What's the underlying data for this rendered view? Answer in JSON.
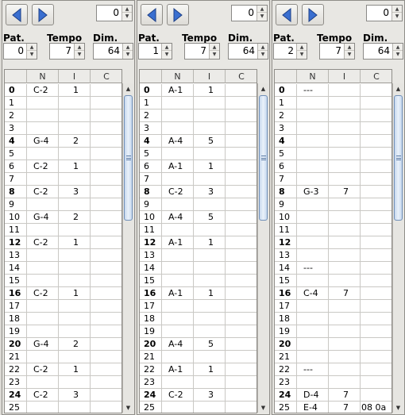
{
  "labels": {
    "pattern": "Pat.",
    "tempo": "Tempo",
    "dim": "Dim."
  },
  "columns": [
    "N",
    "I",
    "C"
  ],
  "panels": [
    {
      "top_value": "0",
      "pattern": "0",
      "tempo": "7",
      "dim": "64",
      "rows": [
        {
          "n": "0",
          "note": "C-2",
          "inst": "1",
          "cmd": ""
        },
        {
          "n": "1",
          "note": "",
          "inst": "",
          "cmd": ""
        },
        {
          "n": "2",
          "note": "",
          "inst": "",
          "cmd": ""
        },
        {
          "n": "3",
          "note": "",
          "inst": "",
          "cmd": ""
        },
        {
          "n": "4",
          "note": "G-4",
          "inst": "2",
          "cmd": ""
        },
        {
          "n": "5",
          "note": "",
          "inst": "",
          "cmd": ""
        },
        {
          "n": "6",
          "note": "C-2",
          "inst": "1",
          "cmd": ""
        },
        {
          "n": "7",
          "note": "",
          "inst": "",
          "cmd": ""
        },
        {
          "n": "8",
          "note": "C-2",
          "inst": "3",
          "cmd": ""
        },
        {
          "n": "9",
          "note": "",
          "inst": "",
          "cmd": ""
        },
        {
          "n": "10",
          "note": "G-4",
          "inst": "2",
          "cmd": ""
        },
        {
          "n": "11",
          "note": "",
          "inst": "",
          "cmd": ""
        },
        {
          "n": "12",
          "note": "C-2",
          "inst": "1",
          "cmd": ""
        },
        {
          "n": "13",
          "note": "",
          "inst": "",
          "cmd": ""
        },
        {
          "n": "14",
          "note": "",
          "inst": "",
          "cmd": ""
        },
        {
          "n": "15",
          "note": "",
          "inst": "",
          "cmd": ""
        },
        {
          "n": "16",
          "note": "C-2",
          "inst": "1",
          "cmd": ""
        },
        {
          "n": "17",
          "note": "",
          "inst": "",
          "cmd": ""
        },
        {
          "n": "18",
          "note": "",
          "inst": "",
          "cmd": ""
        },
        {
          "n": "19",
          "note": "",
          "inst": "",
          "cmd": ""
        },
        {
          "n": "20",
          "note": "G-4",
          "inst": "2",
          "cmd": ""
        },
        {
          "n": "21",
          "note": "",
          "inst": "",
          "cmd": ""
        },
        {
          "n": "22",
          "note": "C-2",
          "inst": "1",
          "cmd": ""
        },
        {
          "n": "23",
          "note": "",
          "inst": "",
          "cmd": ""
        },
        {
          "n": "24",
          "note": "C-2",
          "inst": "3",
          "cmd": ""
        },
        {
          "n": "25",
          "note": "",
          "inst": "",
          "cmd": ""
        }
      ]
    },
    {
      "top_value": "0",
      "pattern": "1",
      "tempo": "7",
      "dim": "64",
      "rows": [
        {
          "n": "0",
          "note": "A-1",
          "inst": "1",
          "cmd": ""
        },
        {
          "n": "1",
          "note": "",
          "inst": "",
          "cmd": ""
        },
        {
          "n": "2",
          "note": "",
          "inst": "",
          "cmd": ""
        },
        {
          "n": "3",
          "note": "",
          "inst": "",
          "cmd": ""
        },
        {
          "n": "4",
          "note": "A-4",
          "inst": "5",
          "cmd": ""
        },
        {
          "n": "5",
          "note": "",
          "inst": "",
          "cmd": ""
        },
        {
          "n": "6",
          "note": "A-1",
          "inst": "1",
          "cmd": ""
        },
        {
          "n": "7",
          "note": "",
          "inst": "",
          "cmd": ""
        },
        {
          "n": "8",
          "note": "C-2",
          "inst": "3",
          "cmd": ""
        },
        {
          "n": "9",
          "note": "",
          "inst": "",
          "cmd": ""
        },
        {
          "n": "10",
          "note": "A-4",
          "inst": "5",
          "cmd": ""
        },
        {
          "n": "11",
          "note": "",
          "inst": "",
          "cmd": ""
        },
        {
          "n": "12",
          "note": "A-1",
          "inst": "1",
          "cmd": ""
        },
        {
          "n": "13",
          "note": "",
          "inst": "",
          "cmd": ""
        },
        {
          "n": "14",
          "note": "",
          "inst": "",
          "cmd": ""
        },
        {
          "n": "15",
          "note": "",
          "inst": "",
          "cmd": ""
        },
        {
          "n": "16",
          "note": "A-1",
          "inst": "1",
          "cmd": ""
        },
        {
          "n": "17",
          "note": "",
          "inst": "",
          "cmd": ""
        },
        {
          "n": "18",
          "note": "",
          "inst": "",
          "cmd": ""
        },
        {
          "n": "19",
          "note": "",
          "inst": "",
          "cmd": ""
        },
        {
          "n": "20",
          "note": "A-4",
          "inst": "5",
          "cmd": ""
        },
        {
          "n": "21",
          "note": "",
          "inst": "",
          "cmd": ""
        },
        {
          "n": "22",
          "note": "A-1",
          "inst": "1",
          "cmd": ""
        },
        {
          "n": "23",
          "note": "",
          "inst": "",
          "cmd": ""
        },
        {
          "n": "24",
          "note": "C-2",
          "inst": "3",
          "cmd": ""
        },
        {
          "n": "25",
          "note": "",
          "inst": "",
          "cmd": ""
        }
      ]
    },
    {
      "top_value": "0",
      "pattern": "2",
      "tempo": "7",
      "dim": "64",
      "rows": [
        {
          "n": "0",
          "note": "---",
          "inst": "",
          "cmd": ""
        },
        {
          "n": "1",
          "note": "",
          "inst": "",
          "cmd": ""
        },
        {
          "n": "2",
          "note": "",
          "inst": "",
          "cmd": ""
        },
        {
          "n": "3",
          "note": "",
          "inst": "",
          "cmd": ""
        },
        {
          "n": "4",
          "note": "",
          "inst": "",
          "cmd": ""
        },
        {
          "n": "5",
          "note": "",
          "inst": "",
          "cmd": ""
        },
        {
          "n": "6",
          "note": "",
          "inst": "",
          "cmd": ""
        },
        {
          "n": "7",
          "note": "",
          "inst": "",
          "cmd": ""
        },
        {
          "n": "8",
          "note": "G-3",
          "inst": "7",
          "cmd": ""
        },
        {
          "n": "9",
          "note": "",
          "inst": "",
          "cmd": ""
        },
        {
          "n": "10",
          "note": "",
          "inst": "",
          "cmd": ""
        },
        {
          "n": "11",
          "note": "",
          "inst": "",
          "cmd": ""
        },
        {
          "n": "12",
          "note": "",
          "inst": "",
          "cmd": ""
        },
        {
          "n": "13",
          "note": "",
          "inst": "",
          "cmd": ""
        },
        {
          "n": "14",
          "note": "---",
          "inst": "",
          "cmd": ""
        },
        {
          "n": "15",
          "note": "",
          "inst": "",
          "cmd": ""
        },
        {
          "n": "16",
          "note": "C-4",
          "inst": "7",
          "cmd": ""
        },
        {
          "n": "17",
          "note": "",
          "inst": "",
          "cmd": ""
        },
        {
          "n": "18",
          "note": "",
          "inst": "",
          "cmd": ""
        },
        {
          "n": "19",
          "note": "",
          "inst": "",
          "cmd": ""
        },
        {
          "n": "20",
          "note": "",
          "inst": "",
          "cmd": ""
        },
        {
          "n": "21",
          "note": "",
          "inst": "",
          "cmd": ""
        },
        {
          "n": "22",
          "note": "---",
          "inst": "",
          "cmd": ""
        },
        {
          "n": "23",
          "note": "",
          "inst": "",
          "cmd": ""
        },
        {
          "n": "24",
          "note": "D-4",
          "inst": "7",
          "cmd": ""
        },
        {
          "n": "25",
          "note": "E-4",
          "inst": "7",
          "cmd": "08 0a"
        }
      ]
    }
  ]
}
